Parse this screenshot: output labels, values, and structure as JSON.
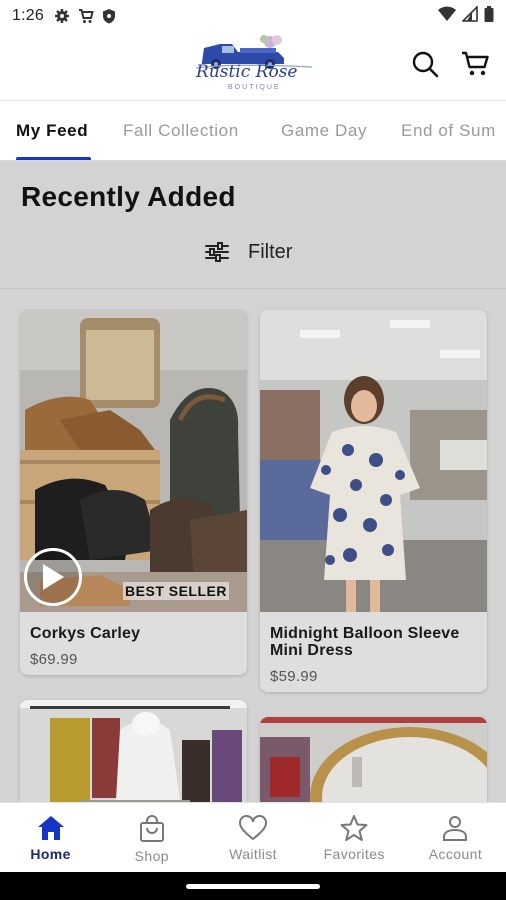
{
  "status_bar": {
    "time": "1:26",
    "left_icons": [
      "gear-icon",
      "cart-icon",
      "shield-icon"
    ],
    "right_icons": [
      "wifi-icon",
      "signal-icon",
      "battery-icon"
    ]
  },
  "header": {
    "logo_text": "Rustic Rose",
    "logo_subtext": "BOUTIQUE",
    "icons": [
      "search-icon",
      "cart-icon"
    ],
    "accent_color": "#1734c4"
  },
  "tabs": [
    {
      "label": "My Feed",
      "active": true
    },
    {
      "label": "Fall Collection",
      "active": false
    },
    {
      "label": "Game Day",
      "active": false
    },
    {
      "label": "End of Sum",
      "active": false
    }
  ],
  "section": {
    "title": "Recently Added",
    "filter_label": "Filter"
  },
  "products": [
    {
      "title": "Corkys Carley",
      "price": "$69.99",
      "badge": "BEST SELLER",
      "has_video": true
    },
    {
      "title": "Midnight Balloon Sleeve Mini Dress",
      "price": "$59.99"
    }
  ],
  "bottom_nav": [
    {
      "label": "Home",
      "icon": "home-icon",
      "active": true
    },
    {
      "label": "Shop",
      "icon": "shopping-bag-icon",
      "active": false
    },
    {
      "label": "Waitlist",
      "icon": "heart-icon",
      "active": false
    },
    {
      "label": "Favorites",
      "icon": "star-icon",
      "active": false
    },
    {
      "label": "Account",
      "icon": "person-icon",
      "active": false
    }
  ]
}
